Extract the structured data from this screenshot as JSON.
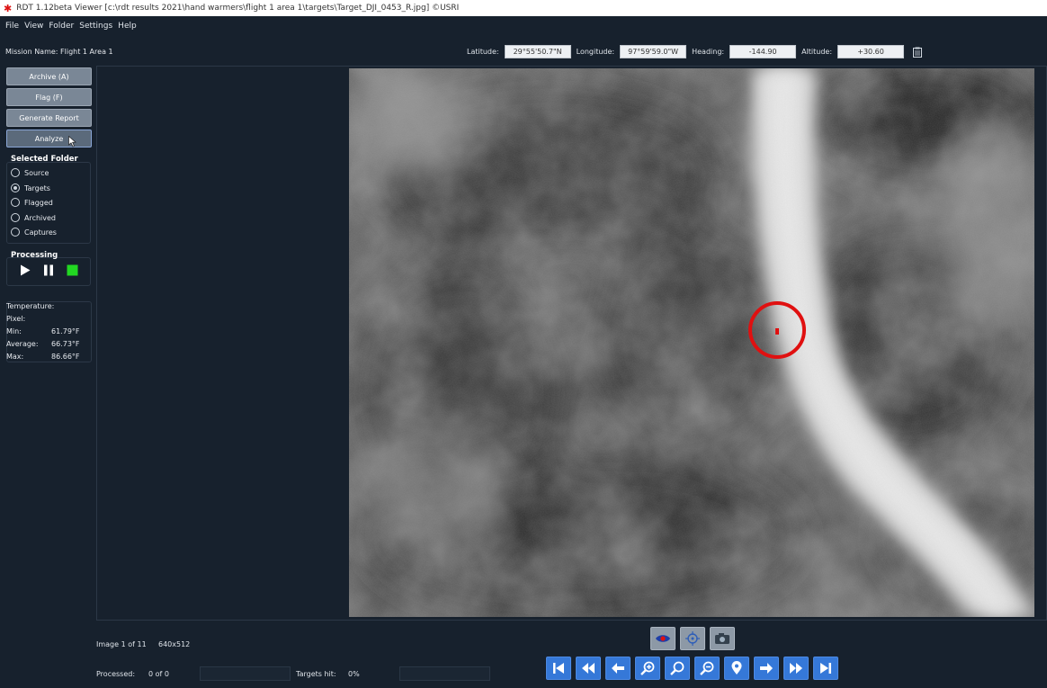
{
  "window": {
    "title": "RDT 1.12beta Viewer [c:\\rdt results 2021\\hand warmers\\flight 1 area 1\\targets\\Target_DJI_0453_R.jpg] ©USRI"
  },
  "menu": [
    "File",
    "View",
    "Folder",
    "Settings",
    "Help"
  ],
  "mission": {
    "label": "Mission Name:",
    "name": "Flight 1 Area 1"
  },
  "telemetry": {
    "latitude_label": "Latitude:",
    "latitude": "29°55'50.7\"N",
    "longitude_label": "Longitude:",
    "longitude": "97°59'59.0\"W",
    "heading_label": "Heading:",
    "heading": "-144.90",
    "altitude_label": "Altitude:",
    "altitude": "+30.60"
  },
  "buttons": {
    "archive": "Archive (A)",
    "flag": "Flag (F)",
    "report": "Generate Report",
    "analyze": "Analyze"
  },
  "selected_folder": {
    "title": "Selected Folder",
    "options": [
      "Source",
      "Targets",
      "Flagged",
      "Archived",
      "Captures"
    ],
    "selected": "Targets"
  },
  "processing": {
    "title": "Processing"
  },
  "temperature": {
    "title": "Temperature:",
    "pixel_label": "Pixel:",
    "min_label": "Min:",
    "min": "61.79°F",
    "avg_label": "Average:",
    "avg": "66.73°F",
    "max_label": "Max:",
    "max": "86.66°F"
  },
  "status": {
    "image_index": "Image 1 of 11",
    "resolution": "640x512",
    "processed_label": "Processed:",
    "processed": "0 of 0",
    "targets_label": "Targets hit:",
    "targets": "0%"
  },
  "colors": {
    "accent_blue": "#3578d8",
    "target_red": "#e01010",
    "stop_green": "#22d822"
  },
  "icons": [
    "eye-icon",
    "crosshair-icon",
    "camera-icon",
    "skip-first-icon",
    "rewind-icon",
    "arrow-left-icon",
    "zoom-in-icon",
    "zoom-fit-icon",
    "zoom-out-icon",
    "location-pin-icon",
    "arrow-right-icon",
    "fast-forward-icon",
    "skip-last-icon",
    "play-icon",
    "pause-icon",
    "stop-icon",
    "clipboard-icon"
  ]
}
